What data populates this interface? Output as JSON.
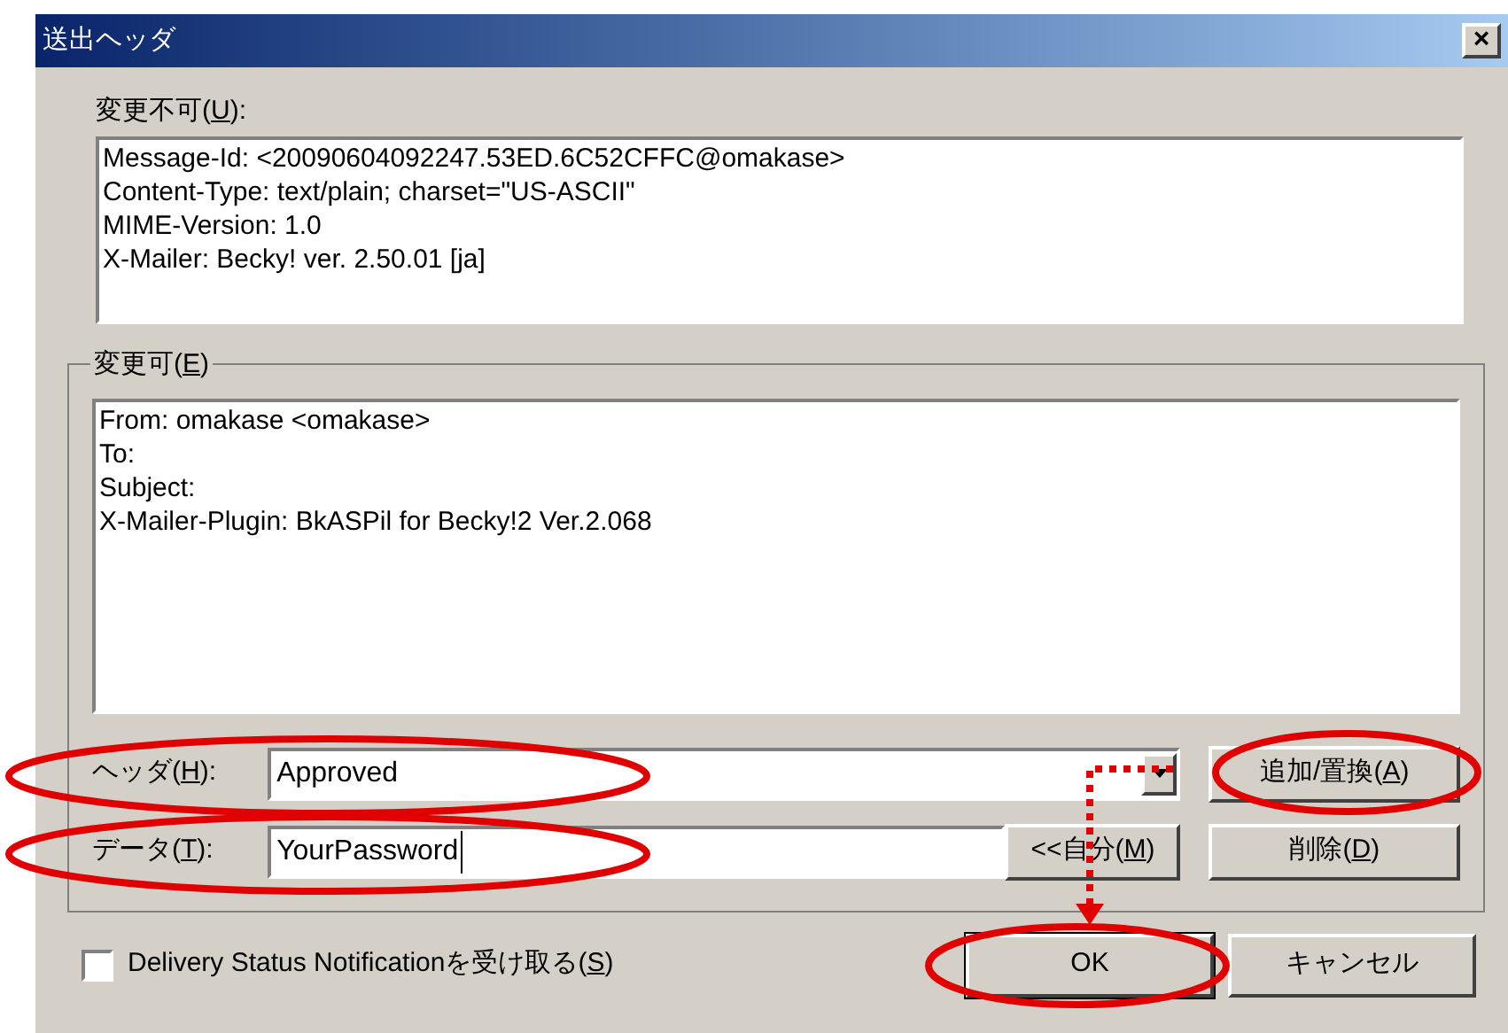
{
  "window": {
    "title": "送出ヘッダ",
    "close": "×"
  },
  "fixed_headers": {
    "label": {
      "text": "変更不可(",
      "key": "U",
      "end": "):"
    },
    "lines": [
      "Message-Id: <20090604092247.53ED.6C52CFFC@omakase>",
      "Content-Type: text/plain; charset=\"US-ASCII\"",
      "MIME-Version: 1.0",
      "X-Mailer: Becky! ver. 2.50.01 [ja]"
    ]
  },
  "editable_headers": {
    "label": {
      "text": "変更可(",
      "key": "E",
      "end": ")"
    },
    "lines": [
      "From: omakase <omakase>",
      "To:",
      "Subject:",
      "X-Mailer-Plugin: BkASPil for Becky!2 Ver.2.068"
    ]
  },
  "header_field": {
    "label": {
      "text": "ヘッダ(",
      "key": "H",
      "end": "):"
    },
    "value": "Approved"
  },
  "data_field": {
    "label": {
      "text": "データ(",
      "key": "T",
      "end": "):"
    },
    "value": "YourPassword"
  },
  "buttons": {
    "add_replace": {
      "text": "追加/置換(",
      "key": "A",
      "end": ")"
    },
    "self": {
      "text": "<<自分(",
      "key": "M",
      "end": ")"
    },
    "delete": {
      "text": "削除(",
      "key": "D",
      "end": ")"
    },
    "ok": {
      "text": "OK"
    },
    "cancel": {
      "text": "キャンセル"
    }
  },
  "dsn": {
    "label": {
      "text": "Delivery Status Notificationを受け取る(",
      "key": "S",
      "end": ")"
    },
    "checked": false
  }
}
